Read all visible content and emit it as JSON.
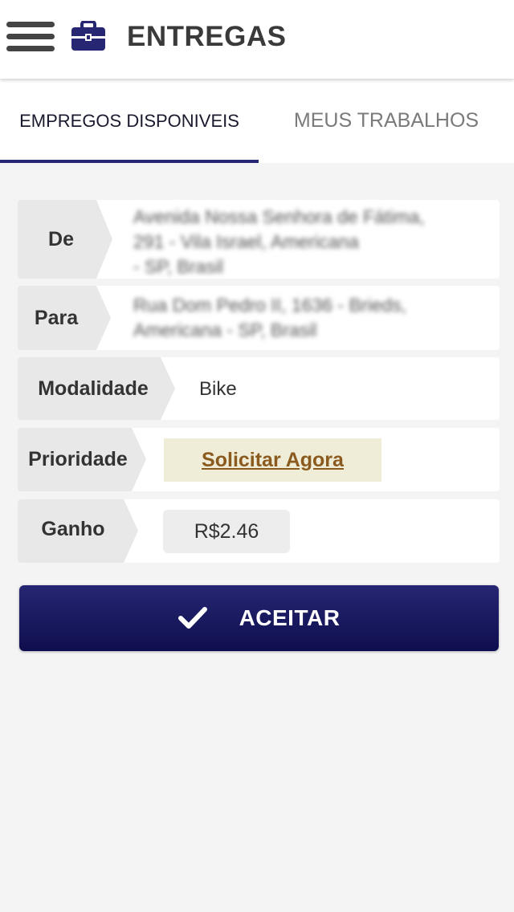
{
  "app": {
    "title": "ENTREGAS",
    "menu_icon": "hamburger-menu-icon",
    "logo_icon": "briefcase-icon",
    "accent_color": "#262673"
  },
  "tabs": [
    {
      "label": "EMPREGOS DISPONIVEIS",
      "selected": true
    },
    {
      "label": "MEUS TRABALHOS",
      "selected": false
    }
  ],
  "job": {
    "from": {
      "label": "De",
      "address_lines": [
        "Avenida Nossa Senhora de Fátima,",
        "291 - Vila Israel, Americana",
        "- SP, Brasil"
      ]
    },
    "to": {
      "label": "Para",
      "address_lines": [
        "Rua Dom Pedro II, 1636 - Brieds,",
        "Americana - SP, Brasil"
      ]
    },
    "mode": {
      "label": "Modalidade",
      "value": "Bike"
    },
    "priority": {
      "label": "Prioridade",
      "value": "Solicitar Agora"
    },
    "earning": {
      "label": "Ganho",
      "value": "R$2.46"
    }
  },
  "actions": {
    "accept_label": "ACEITAR",
    "accept_icon": "check-icon"
  }
}
